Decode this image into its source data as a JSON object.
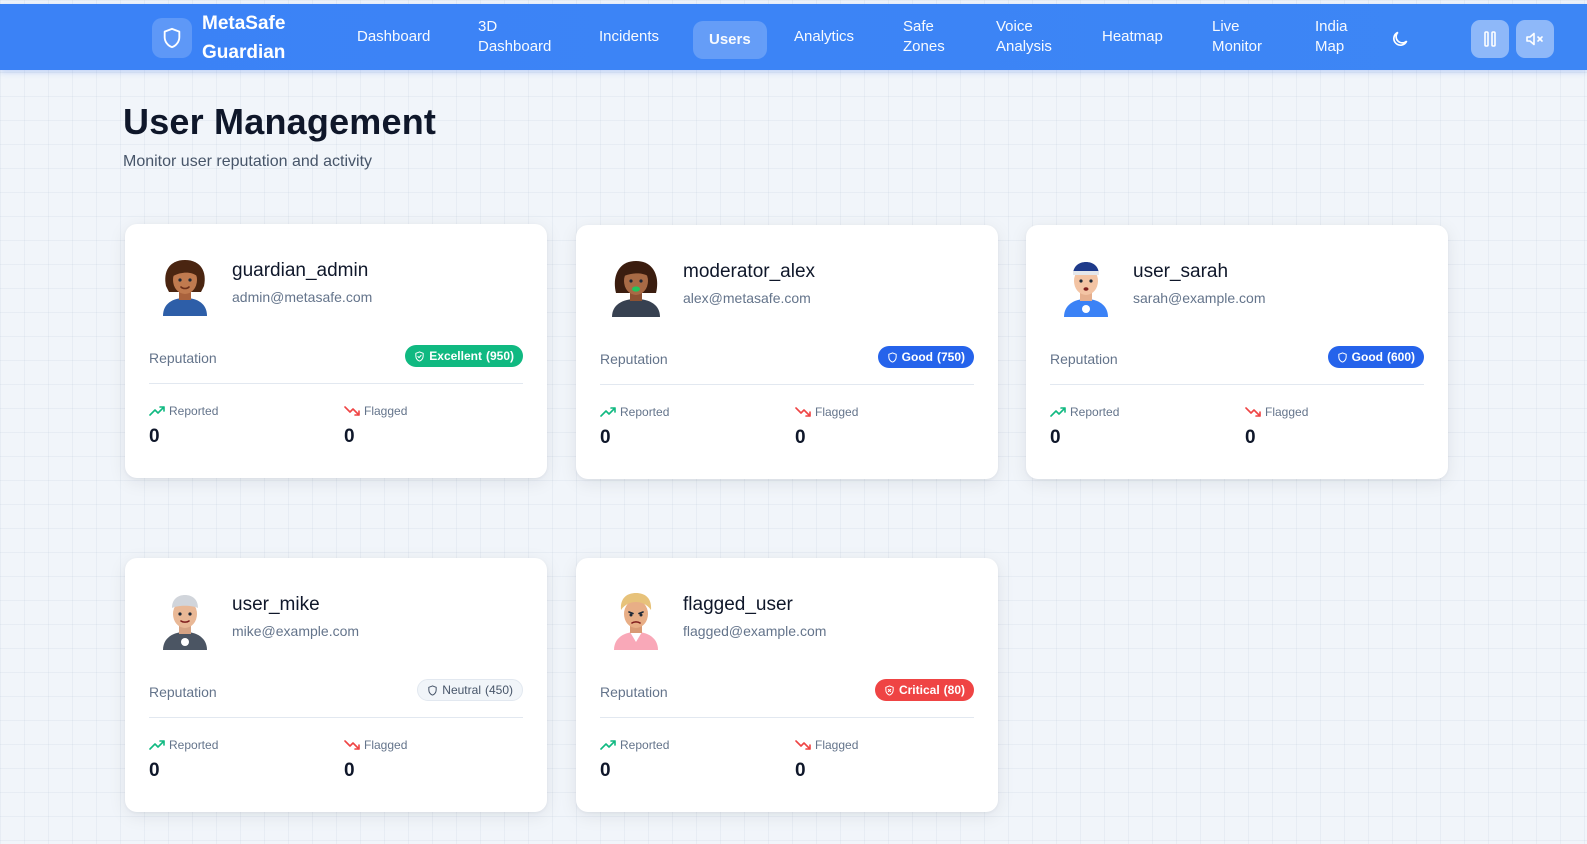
{
  "app": {
    "name_line1": "MetaSafe",
    "name_line2": "Guardian",
    "brand_icon": "shield-icon"
  },
  "nav": {
    "items": [
      {
        "label": "Dashboard"
      },
      {
        "label": "3D Dashboard"
      },
      {
        "label": "Incidents"
      },
      {
        "label": "Users",
        "active": true
      },
      {
        "label": "Analytics"
      },
      {
        "label": "Safe Zones"
      },
      {
        "label": "Voice Analysis"
      },
      {
        "label": "Heatmap"
      },
      {
        "label": "Live Monitor"
      },
      {
        "label": "India Map"
      }
    ],
    "theme_icon": "moon-icon",
    "tools": [
      "pause-icon",
      "mute-icon"
    ]
  },
  "page": {
    "title": "User Management",
    "subtitle": "Monitor user reputation and activity"
  },
  "labels": {
    "reputation": "Reputation",
    "reported": "Reported",
    "flagged": "Flagged"
  },
  "colors": {
    "primary": "#3b82f6",
    "excellent": "#10b981",
    "good": "#2563eb",
    "critical": "#ef4444",
    "reported_icon": "#10b981",
    "flagged_icon": "#ef4444"
  },
  "users": [
    {
      "name": "guardian_admin",
      "email": "admin@metasafe.com",
      "badge_label": "Excellent",
      "badge_score": "(950)",
      "badge_kind": "excellent",
      "reported": "0",
      "flagged": "0"
    },
    {
      "name": "moderator_alex",
      "email": "alex@metasafe.com",
      "badge_label": "Good",
      "badge_score": "(750)",
      "badge_kind": "good",
      "reported": "0",
      "flagged": "0"
    },
    {
      "name": "user_sarah",
      "email": "sarah@example.com",
      "badge_label": "Good",
      "badge_score": "(600)",
      "badge_kind": "good",
      "reported": "0",
      "flagged": "0"
    },
    {
      "name": "user_mike",
      "email": "mike@example.com",
      "badge_label": "Neutral",
      "badge_score": "(450)",
      "badge_kind": "neutral",
      "reported": "0",
      "flagged": "0"
    },
    {
      "name": "flagged_user",
      "email": "flagged@example.com",
      "badge_label": "Critical",
      "badge_score": "(80)",
      "badge_kind": "critical",
      "reported": "0",
      "flagged": "0"
    }
  ]
}
